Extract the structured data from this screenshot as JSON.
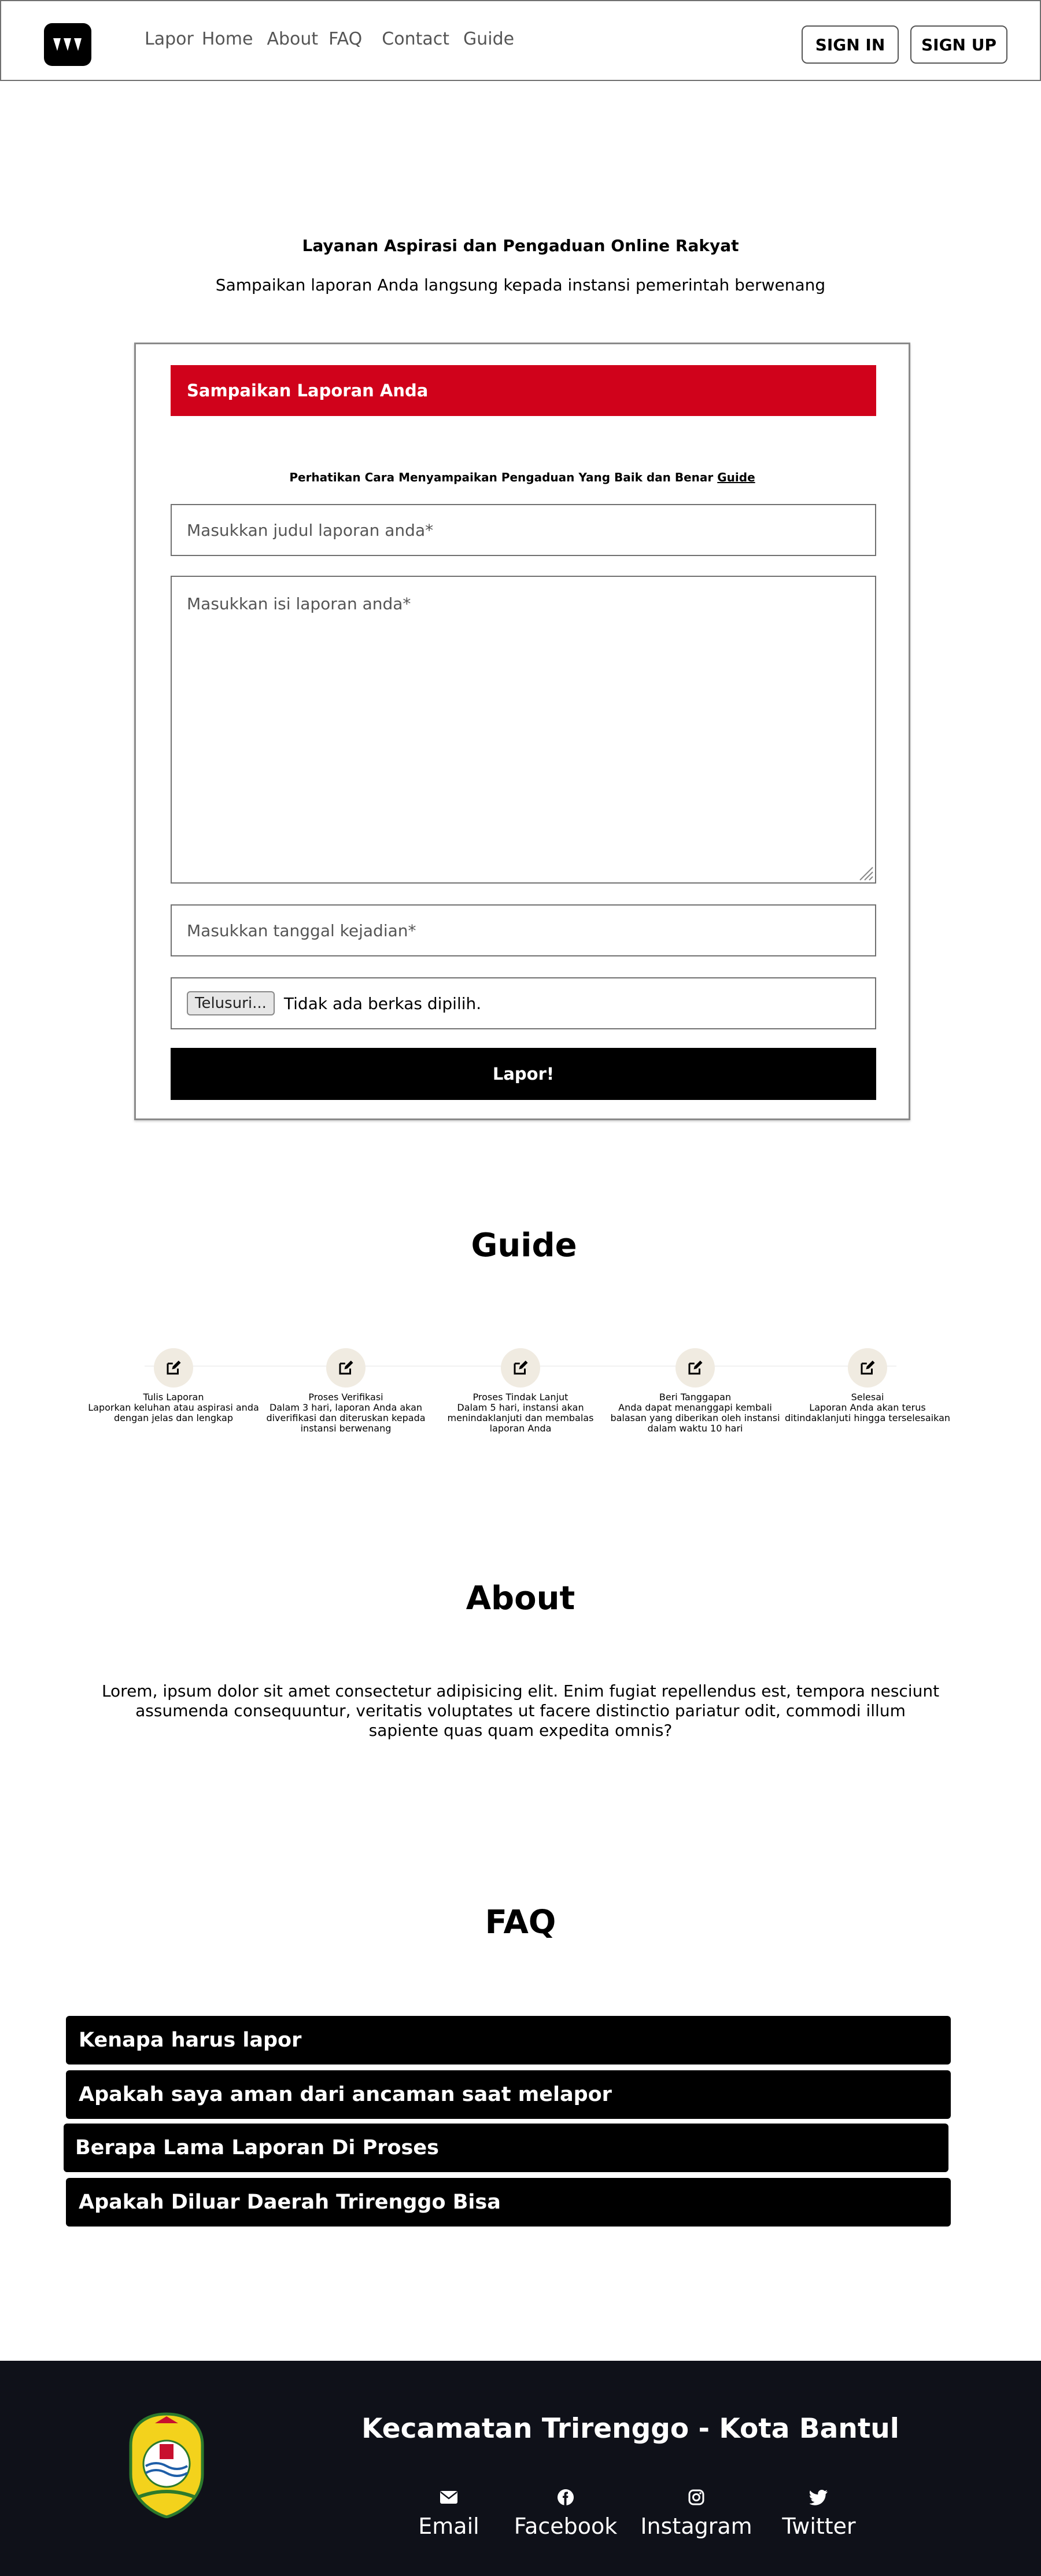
{
  "nav": {
    "links": [
      "Lapor",
      "Home",
      "About",
      "FAQ",
      "Contact",
      "Guide"
    ],
    "sign_in": "SIGN IN",
    "sign_up": "SIGN UP"
  },
  "hero": {
    "title": "Layanan Aspirasi dan Pengaduan Online Rakyat",
    "subtitle": "Sampaikan laporan Anda langsung kepada instansi pemerintah berwenang"
  },
  "form": {
    "header": "Sampaikan Laporan Anda",
    "notice_text": "Perhatikan Cara Menyampaikan Pengaduan Yang Baik dan Benar",
    "notice_link": "Guide",
    "title_placeholder": "Masukkan judul laporan anda*",
    "body_placeholder": "Masukkan isi laporan anda*",
    "date_placeholder": "Masukkan tanggal kejadian*",
    "file_button": "Telusuri...",
    "file_status": "Tidak ada berkas dipilih.",
    "submit": "Lapor!"
  },
  "guide": {
    "title": "Guide",
    "steps": [
      {
        "name": "Tulis Laporan",
        "desc": "Laporkan keluhan atau aspirasi anda dengan jelas dan lengkap",
        "icon": "edit-icon"
      },
      {
        "name": "Proses Verifikasi",
        "desc": "Dalam 3 hari, laporan Anda akan diverifikasi dan diteruskan kepada instansi berwenang",
        "icon": "edit-icon"
      },
      {
        "name": "Proses Tindak Lanjut",
        "desc": "Dalam 5 hari, instansi akan menindaklanjuti dan membalas laporan Anda",
        "icon": "edit-icon"
      },
      {
        "name": "Beri Tanggapan",
        "desc": "Anda dapat menanggapi kembali balasan yang diberikan oleh instansi dalam waktu 10 hari",
        "icon": "edit-icon"
      },
      {
        "name": "Selesai",
        "desc": "Laporan Anda akan terus ditindaklanjuti hingga terselesaikan",
        "icon": "edit-icon"
      }
    ]
  },
  "about": {
    "title": "About",
    "text": "Lorem, ipsum dolor sit amet consectetur adipisicing elit. Enim fugiat repellendus est, tempora nesciunt assumenda consequuntur, veritatis voluptates ut facere distinctio pariatur odit, commodi illum sapiente quas quam expedita omnis?"
  },
  "faq": {
    "title": "FAQ",
    "items": [
      "Kenapa harus lapor",
      "Apakah saya aman dari ancaman saat melapor",
      "Berapa Lama Laporan Di Proses",
      "Apakah Diluar Daerah Trirenggo Bisa"
    ]
  },
  "footer": {
    "title": "Kecamatan Trirenggo - Kota Bantul",
    "socials": [
      {
        "label": "Email",
        "icon": "envelope-icon"
      },
      {
        "label": "Facebook",
        "icon": "facebook-icon"
      },
      {
        "label": "Instagram",
        "icon": "instagram-icon"
      },
      {
        "label": "Twitter",
        "icon": "twitter-icon"
      }
    ]
  },
  "colors": {
    "accent": "#d0021b",
    "footer_bg": "#0f1119",
    "step_icon_bg": "#f0ebe1"
  }
}
